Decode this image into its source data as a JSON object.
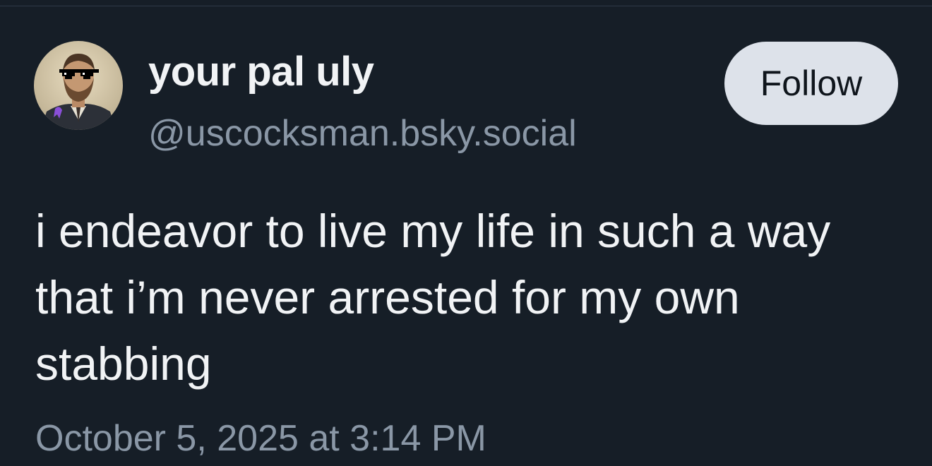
{
  "author": {
    "display_name": "your pal uly",
    "handle": "@uscocksman.bsky.social",
    "avatar_icon": "portrait-with-pixel-sunglasses-avatar"
  },
  "actions": {
    "follow_label": "Follow"
  },
  "post": {
    "text": "i endeavor to live my life in such a way that i’m never arrested for my own stabbing",
    "timestamp": "October 5, 2025 at 3:14 PM"
  },
  "colors": {
    "background": "#161e27",
    "text_primary": "#f1f3f5",
    "text_secondary": "#8a97a6",
    "follow_button_bg": "#dde2ea",
    "follow_button_text": "#0f151c"
  }
}
